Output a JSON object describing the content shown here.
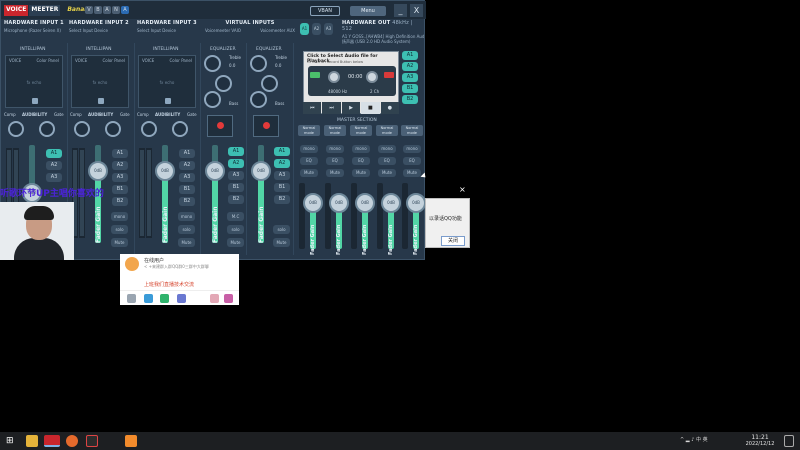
{
  "app": {
    "brand_voice": "VOICE",
    "brand_meter": "MEETER",
    "brand_banana": "Banana",
    "badges": [
      "V",
      "B",
      "A",
      "N",
      "A",
      "A"
    ],
    "vban": "VBAN",
    "menu": "Menu",
    "minimize": "_",
    "close": "X"
  },
  "sections": {
    "hw1": {
      "title": "HARDWARE INPUT 1",
      "sub": "Microphone (Razer Seiren X)"
    },
    "hw2": {
      "title": "HARDWARE INPUT 2",
      "sub": "Select Input Device"
    },
    "hw3": {
      "title": "HARDWARE INPUT 3",
      "sub": "Select Input Device"
    },
    "virtual": {
      "title": "VIRTUAL INPUTS",
      "left": "Voicemeeter VAIO",
      "right": "Voicemeeter AUX"
    },
    "a_buttons": [
      "A1",
      "A2",
      "A3"
    ],
    "hwout": {
      "title": "HARDWARE OUT",
      "rate": "48kHz | 512",
      "sub": "A1 Y GOSS..[AHWB4] High Definition Audio",
      "sub2": "扬声器 (USB 2.0 HD Audio System)"
    }
  },
  "strips": {
    "intelli": "INTELLIPAN",
    "voice": "VOICE",
    "color_panel": "Color Panel",
    "center_text": "fx echo",
    "comp": "Comp",
    "audibility": "AUDIBILITY",
    "gate": "Gate",
    "fader_label": "Fader Gain",
    "fader_value": "0dB",
    "bus_buttons": [
      "A1",
      "A2",
      "A3",
      "B1",
      "B2"
    ],
    "mono": "mono",
    "solo": "solo",
    "mute": "Mute",
    "mc": "M.C"
  },
  "virtual_strip": {
    "equalizer": "EQUALIZER",
    "treble": "Treble",
    "bass": "Bass",
    "value": "0.0"
  },
  "recorder": {
    "title": "Click to Select Audio file for Playback",
    "subtitle": "Or click on Record Button below",
    "time": "00:00",
    "rate": "48000 Hz",
    "channels": "2 Ch",
    "controls": [
      "⏮",
      "⏭",
      "▶",
      "■",
      "●"
    ]
  },
  "outputs": [
    "A1",
    "A2",
    "A3",
    "B1",
    "B2"
  ],
  "master": {
    "label": "MASTER SECTION",
    "mode": "Normal mode",
    "mono": "mono",
    "eq": "EQ",
    "mute": "Mute",
    "fader_label": "Fader Gain",
    "fader_value": "0dB"
  },
  "overlay": {
    "purple": "听歌环节UP主唱你喜欢的",
    "qq_name": "在线用户",
    "qq_msg": "< +来建群入群QQ群0三群中大群聊",
    "qq_red": "上班我们直播技术交流",
    "popup_msg": "以录话QQ功能",
    "popup_btn": "关闭"
  },
  "taskbar": {
    "tray": "^ ▂ ♪ 中 英",
    "time": "11:21",
    "date": "2022/12/12"
  },
  "colors": {
    "panel": "#27384a",
    "accent": "#3dbfb2",
    "fader": "#52d6a6",
    "brand_red": "#c9262d"
  }
}
